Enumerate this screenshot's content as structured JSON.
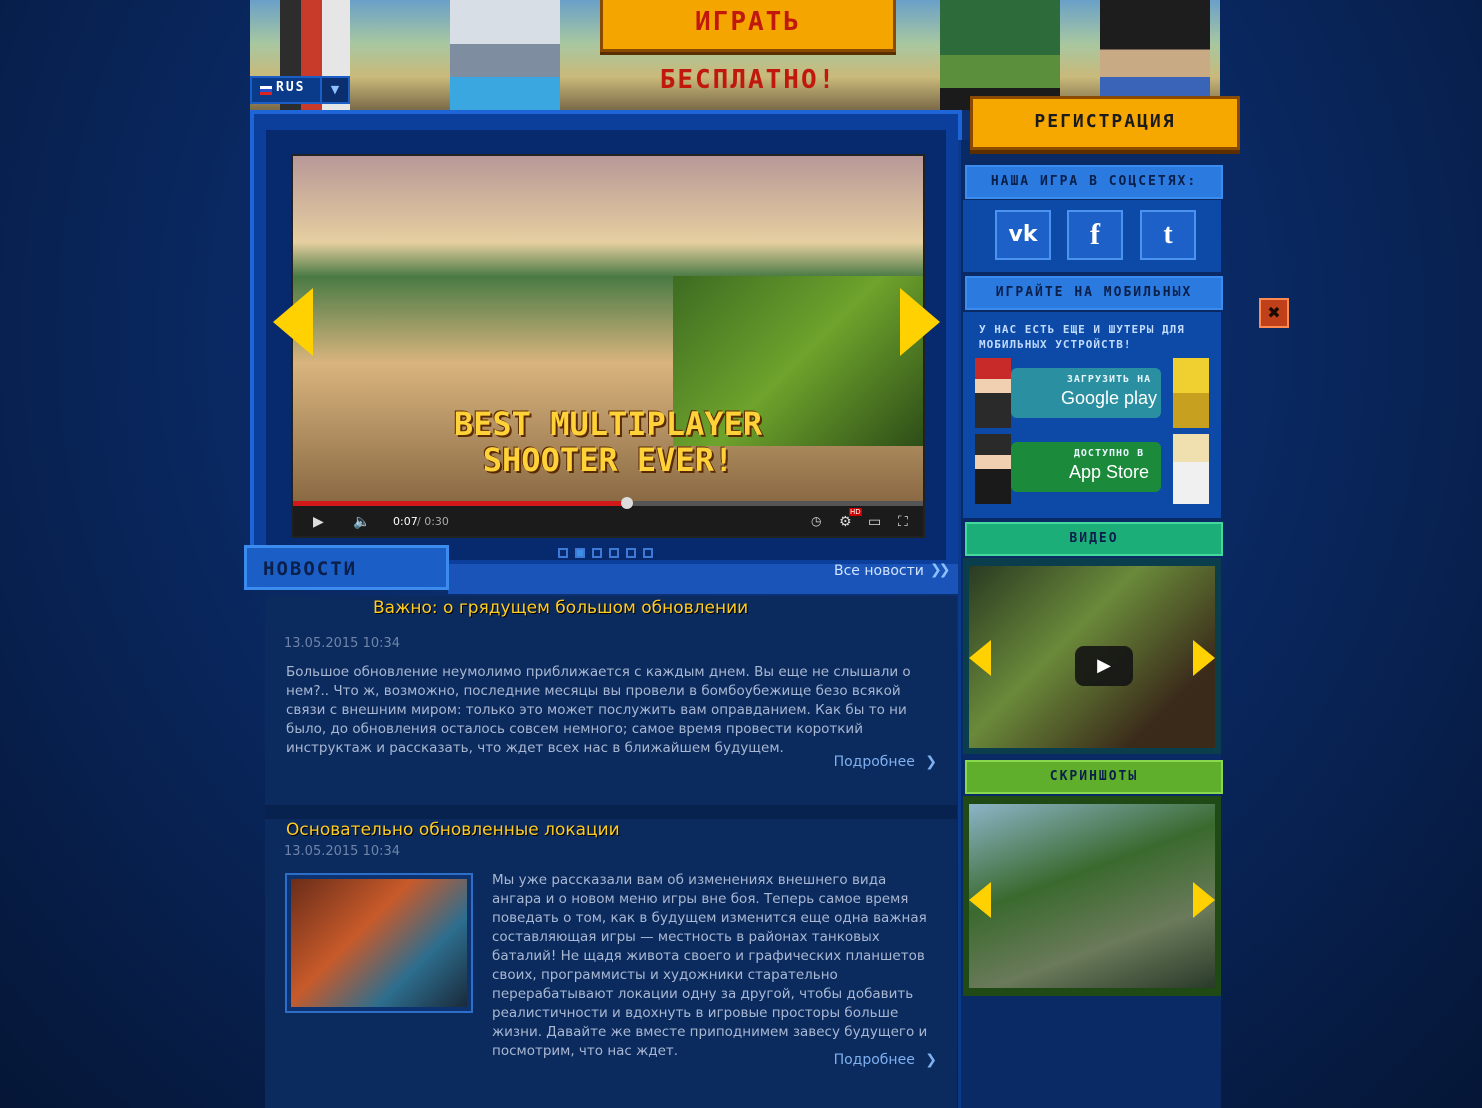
{
  "banner": {
    "play_free": "ИГРАТЬ БЕСПЛАТНО!"
  },
  "language": {
    "code": "RUS",
    "flag_icon": "ru-flag-icon"
  },
  "slider": {
    "video_caption": "BEST MULTIPLAYER\nSHOOTER EVER!",
    "time_current": "0:07",
    "time_total": "/ 0:30",
    "progress_fraction": 0.53,
    "dots_count": 6,
    "active_dot": 1,
    "hd_badge": "HD"
  },
  "news": {
    "title": "НОВОСТИ",
    "all_news": "Все новости",
    "articles": [
      {
        "title": "Важно: о грядущем большом обновлении",
        "date": "13.05.2015  10:34",
        "text": "Большое обновление неумолимо приближается с каждым днем. Вы еще не слышали о нем?.. Что ж, возможно, последние месяцы вы провели в бомбоубежище безо всякой связи с внешним миром: только это может послужить вам оправданием. Как бы то ни было, до обновления осталось совсем немного; самое время провести короткий инструктаж и рассказать, что ждет всех нас в ближайшем будущем.",
        "more": "Подробнее"
      },
      {
        "title": "Основательно обновленные локации",
        "date": "13.05.2015  10:34",
        "text": "Мы уже рассказали вам об изменениях внешнего вида ангара и о новом меню игры вне боя. Теперь самое время поведать о том, как в будущем изменится еще одна важная составляющая игры — местность в районах танковых баталий! Не щадя живота своего и графических планшетов своих, программисты и художники старательно перерабатывают локации одну за другой, чтобы добавить реалистичности и вдохнуть в игровые просторы больше жизни. Давайте же вместе приподнимем завесу будущего и посмотрим, что нас ждет.",
        "more": "Подробнее"
      }
    ]
  },
  "sidebar": {
    "register": "РЕГИСТРАЦИЯ",
    "social_title": "НАША ИГРА В СОЦСЕТЯХ:",
    "social": [
      {
        "label": "vk",
        "icon": "vk-icon"
      },
      {
        "label": "f",
        "icon": "facebook-icon"
      },
      {
        "label": "t",
        "icon": "twitter-icon"
      }
    ],
    "mobile_title": "ИГРАЙТЕ НА МОБИЛЬНЫХ",
    "mobile_text": "У НАС ЕСТЬ ЕЩЕ И ШУТЕРЫ ДЛЯ МОБИЛЬНЫХ УСТРОЙСТВ!",
    "google_play_small": "ЗАГРУЗИТЬ НА",
    "google_play_big": "Google play",
    "app_store_small": "ДОСТУПНО В",
    "app_store_big": "App Store",
    "video_title": "ВИДЕО",
    "screens_title": "СКРИНШОТЫ"
  },
  "colors": {
    "accent_orange": "#f6a700",
    "title_yellow": "#ffcc22",
    "link_blue": "#7fb0f0"
  }
}
